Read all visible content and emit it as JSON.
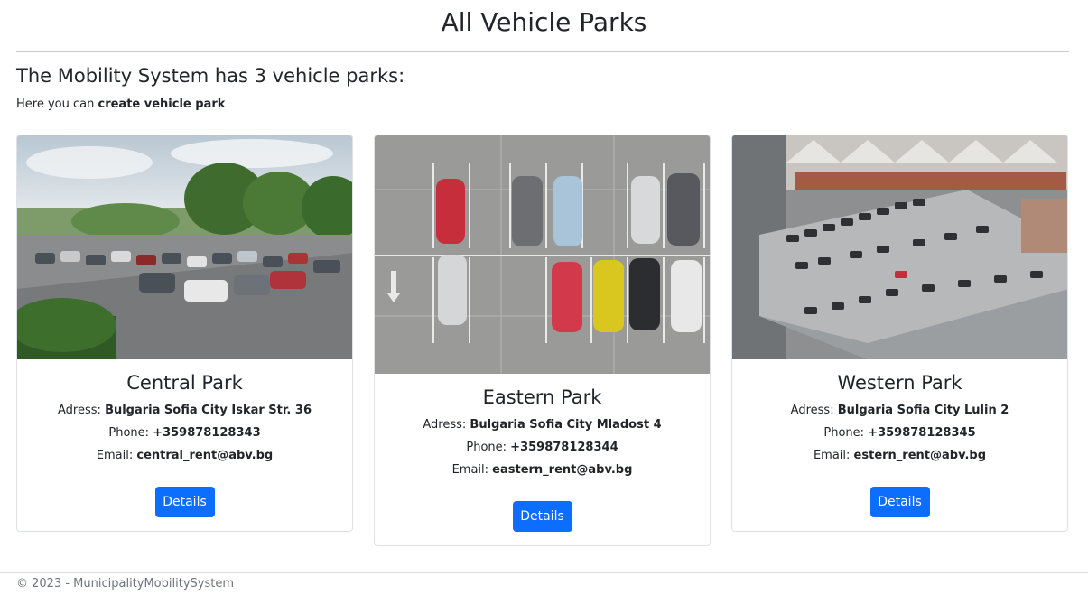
{
  "header": {
    "title": "All Vehicle Parks"
  },
  "summary": {
    "heading": "The Mobility System has 3 vehicle parks:",
    "intro_prefix": "Here you can",
    "create_link": "create vehicle park"
  },
  "parks": [
    {
      "name": "Central Park",
      "address_label": "Adress:",
      "address": "Bulgaria Sofia City Iskar Str. 36",
      "phone_label": "Phone:",
      "phone": "+359878128343",
      "email_label": "Email:",
      "email": "central_rent@abv.bg",
      "button": "Details",
      "image": "parking-lot-photo"
    },
    {
      "name": "Eastern Park",
      "address_label": "Adress:",
      "address": "Bulgaria Sofia City Mladost 4",
      "phone_label": "Phone:",
      "phone": "+359878128344",
      "email_label": "Email:",
      "email": "eastern_rent@abv.bg",
      "button": "Details",
      "image": "aerial-parking-photo"
    },
    {
      "name": "Western Park",
      "address_label": "Adress:",
      "address": "Bulgaria Sofia City Lulin 2",
      "phone_label": "Phone:",
      "phone": "+359878128345",
      "email_label": "Email:",
      "email": "estern_rent@abv.bg",
      "button": "Details",
      "image": "parking-garage-photo"
    }
  ],
  "footer": {
    "text": "© 2023 - MunicipalityMobilitySystem"
  },
  "colors": {
    "primary": "#0d6efd",
    "muted": "#6c757d"
  }
}
